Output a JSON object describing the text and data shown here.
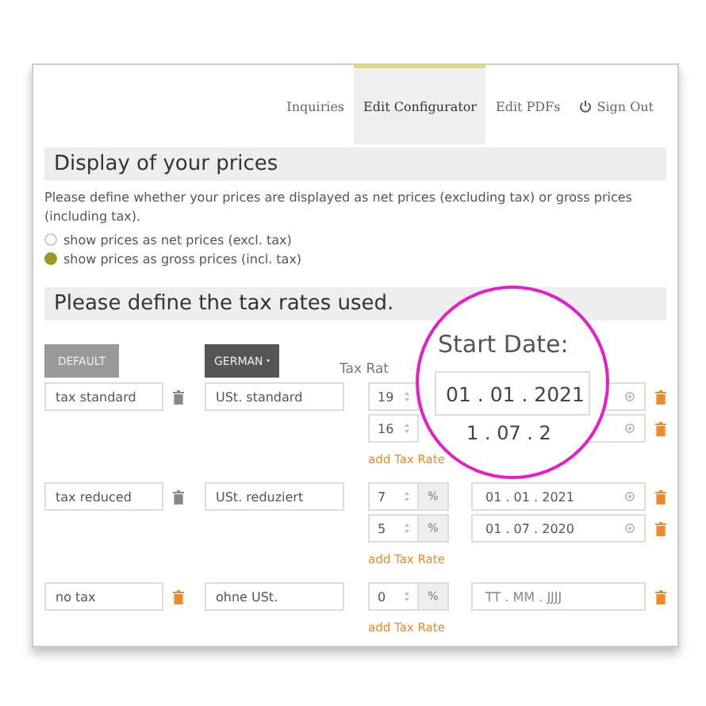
{
  "nav": [
    {
      "label": "Inquiries",
      "selected": false,
      "kind": "link"
    },
    {
      "label": "Edit Configurator",
      "selected": true,
      "kind": "link"
    },
    {
      "label": "Edit PDFs",
      "selected": false,
      "kind": "link"
    },
    {
      "label": "Sign Out",
      "selected": false,
      "kind": "signout"
    }
  ],
  "display_section": {
    "title": "Display of your prices",
    "description": "Please define whether your prices are displayed as net prices (excluding tax) or gross prices (including tax).",
    "options": [
      {
        "label": "show prices as net prices (excl. tax)",
        "selected": false
      },
      {
        "label": "show prices as gross prices (incl. tax)",
        "selected": true
      }
    ]
  },
  "tax_section": {
    "title": "Please define the tax rates used.",
    "default_button": "DEFAULT",
    "language_button": "GERMAN",
    "rate_header": "Tax Rat",
    "rows": [
      {
        "name": "tax standard",
        "name_deletable": false,
        "translation": "USt. standard",
        "add_link": "add Tax Rate",
        "rates": [
          {
            "value": "19",
            "covered": true
          },
          {
            "value": "16",
            "covered": true
          }
        ]
      },
      {
        "name": "tax reduced",
        "name_deletable": false,
        "translation": "USt. reduziert",
        "add_link": "add Tax Rate",
        "rates": [
          {
            "value": "7",
            "unit": "%",
            "date": "01 . 01 . 2021",
            "covered": false
          },
          {
            "value": "5",
            "unit": "%",
            "date": "01 . 07 . 2020",
            "covered": false
          }
        ]
      },
      {
        "name": "no tax",
        "name_deletable": true,
        "translation": "ohne USt.",
        "add_link": "add Tax Rate",
        "rates": [
          {
            "value": "0",
            "unit": "%",
            "placeholder": "TT . MM . JJJJ",
            "covered": false
          }
        ]
      }
    ]
  },
  "magnifier": {
    "label": "Start Date:",
    "value": "01 . 01 . 2021",
    "partial": "1 . 07 . 2"
  }
}
